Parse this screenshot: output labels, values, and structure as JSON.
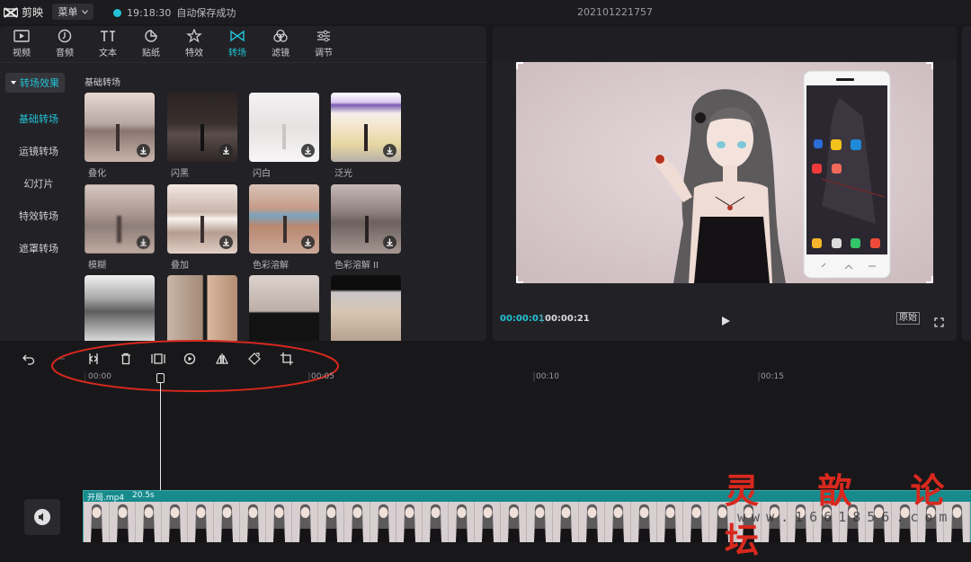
{
  "app": {
    "name": "剪映",
    "menu_label": "菜单",
    "save_time": "19:18:30",
    "save_status": "自动保存成功",
    "project_name": "202101221757"
  },
  "tool_tabs": [
    {
      "label": "视频",
      "icon": "video-icon"
    },
    {
      "label": "音频",
      "icon": "audio-icon"
    },
    {
      "label": "文本",
      "icon": "text-icon"
    },
    {
      "label": "贴纸",
      "icon": "sticker-icon"
    },
    {
      "label": "特效",
      "icon": "effects-icon"
    },
    {
      "label": "转场",
      "icon": "transition-icon",
      "active": true
    },
    {
      "label": "滤镜",
      "icon": "filter-icon"
    },
    {
      "label": "调节",
      "icon": "adjust-icon"
    }
  ],
  "sidebar": {
    "active": "转场效果",
    "items": [
      "基础转场",
      "运镜转场",
      "幻灯片",
      "特效转场",
      "遮罩转场"
    ]
  },
  "section_title": "基础转场",
  "transitions": [
    {
      "label": "叠化"
    },
    {
      "label": "闪黑"
    },
    {
      "label": "闪白"
    },
    {
      "label": "泛光"
    },
    {
      "label": "模糊"
    },
    {
      "label": "叠加"
    },
    {
      "label": "色彩溶解"
    },
    {
      "label": "色彩溶解 II"
    },
    {
      "label": ""
    },
    {
      "label": ""
    },
    {
      "label": ""
    },
    {
      "label": ""
    }
  ],
  "player": {
    "current_time": "00:00:01",
    "total_time": "00:00:21",
    "ratio_label": "原始"
  },
  "timeline": {
    "ruler": [
      "00:00",
      "00:05",
      "00:10",
      "00:15"
    ],
    "clip_name": "开局.mp4",
    "clip_duration": "20.5s"
  },
  "watermark": {
    "text": "灵 歆 论 坛",
    "url": "www.1661856.com"
  },
  "colors": {
    "accent": "#22c3d6",
    "clip": "#178a8c",
    "annotation": "#d8281e"
  }
}
